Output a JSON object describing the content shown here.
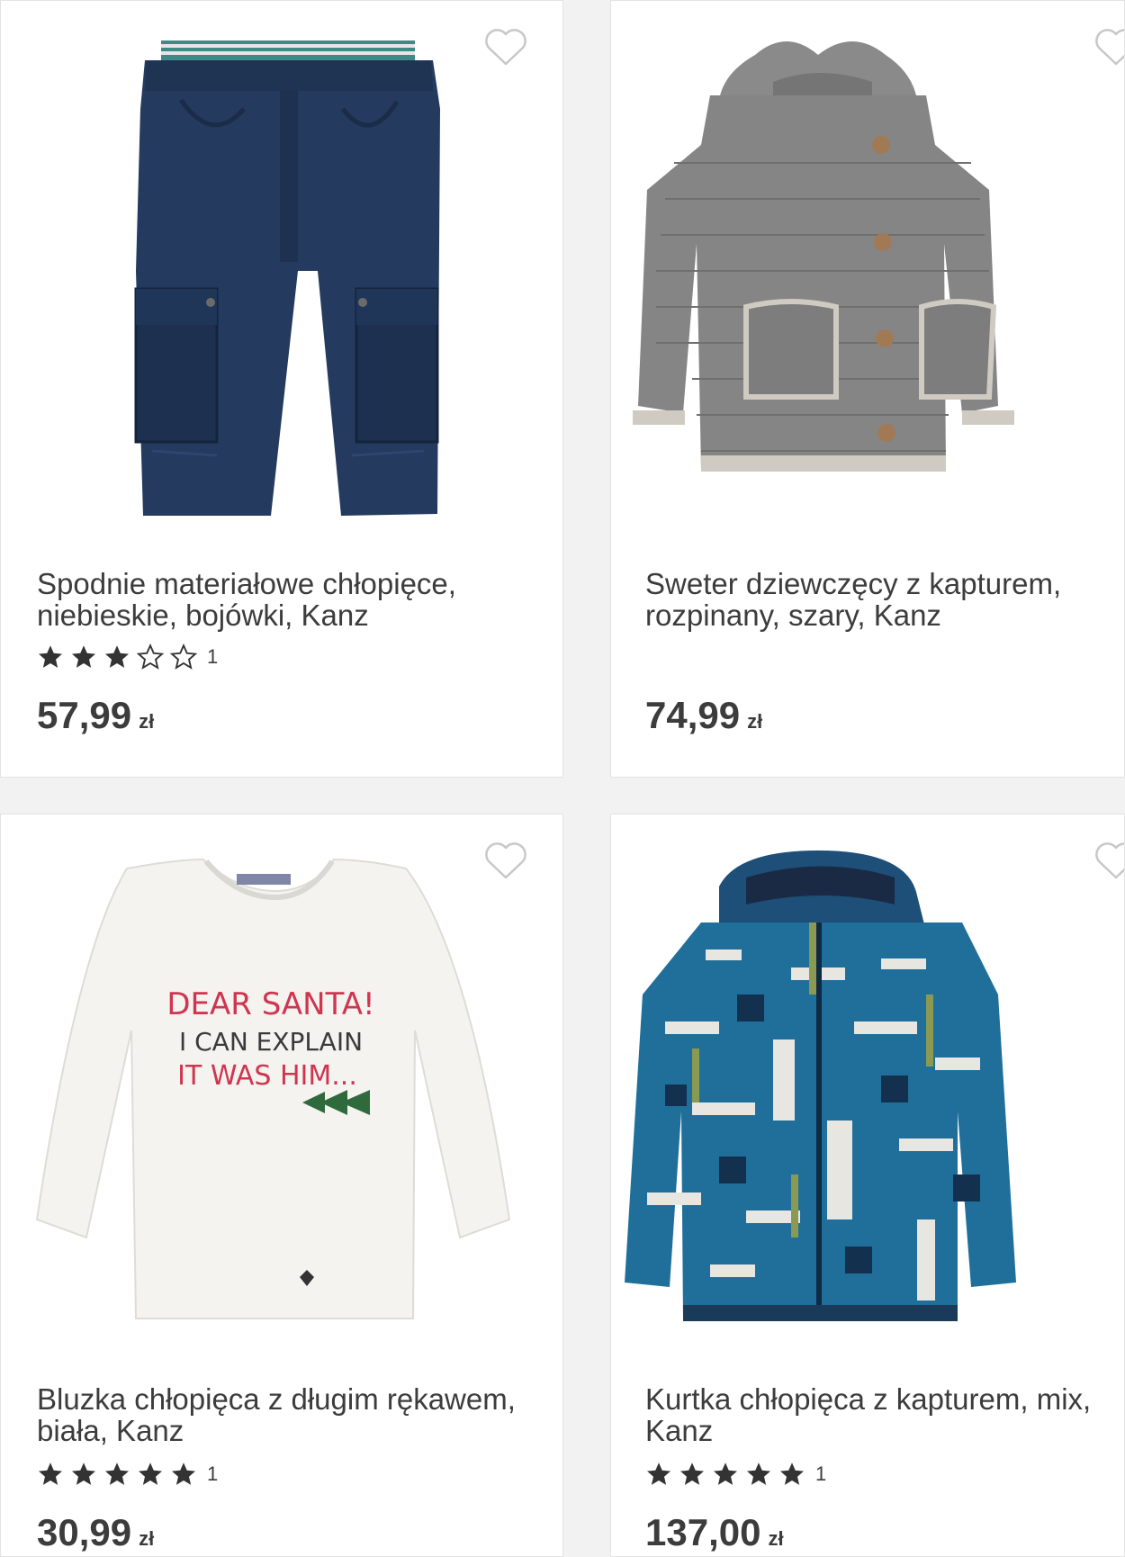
{
  "products": [
    {
      "title": "Spodnie materiałowe chłopięce, niebieskie, bojówki, Kanz",
      "rating_count": "1",
      "rating": 3,
      "price": "57,99",
      "currency": "zł",
      "image_icon": "cargo-pants-image"
    },
    {
      "title": "Sweter dziewczęcy z kapturem, rozpinany, szary, Kanz",
      "price": "74,99",
      "currency": "zł",
      "image_icon": "grey-knit-hoodie-image"
    },
    {
      "title": "Bluzka chłopięca z długim rękawem, biała, Kanz",
      "rating_count": "1",
      "rating": 5,
      "price": "30,99",
      "currency": "zł",
      "image_icon": "white-longsleeve-shirt-image",
      "shirt_print": [
        "DEAR SANTA!",
        "I CAN EXPLAIN",
        "IT WAS HIM..."
      ]
    },
    {
      "title": "Kurtka chłopięca z kapturem, mix, Kanz",
      "rating_count": "1",
      "rating": 5,
      "price": "137,00",
      "currency": "zł",
      "image_icon": "blue-patterned-jacket-image"
    }
  ],
  "colors": {
    "text": "#3c3c3c",
    "star": "#333333",
    "heart_outline": "#c8c8c8",
    "card_bg": "#ffffff",
    "page_bg": "#f2f2f2"
  }
}
